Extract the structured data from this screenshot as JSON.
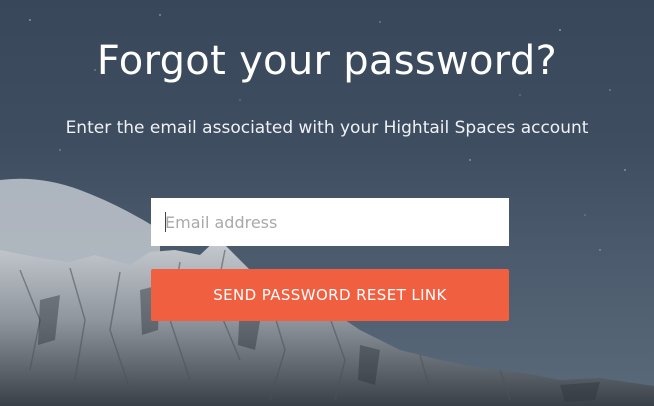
{
  "page": {
    "title": "Forgot your password?",
    "subtitle": "Enter the email associated with your Hightail Spaces account"
  },
  "form": {
    "email_placeholder": "Email address",
    "email_value": "",
    "submit_label": "SEND PASSWORD RESET LINK"
  },
  "colors": {
    "accent": "#f05f40",
    "sky": "#3e4d60",
    "text": "#ffffff"
  },
  "background": {
    "scene": "snowy-mountain-night-sky"
  }
}
